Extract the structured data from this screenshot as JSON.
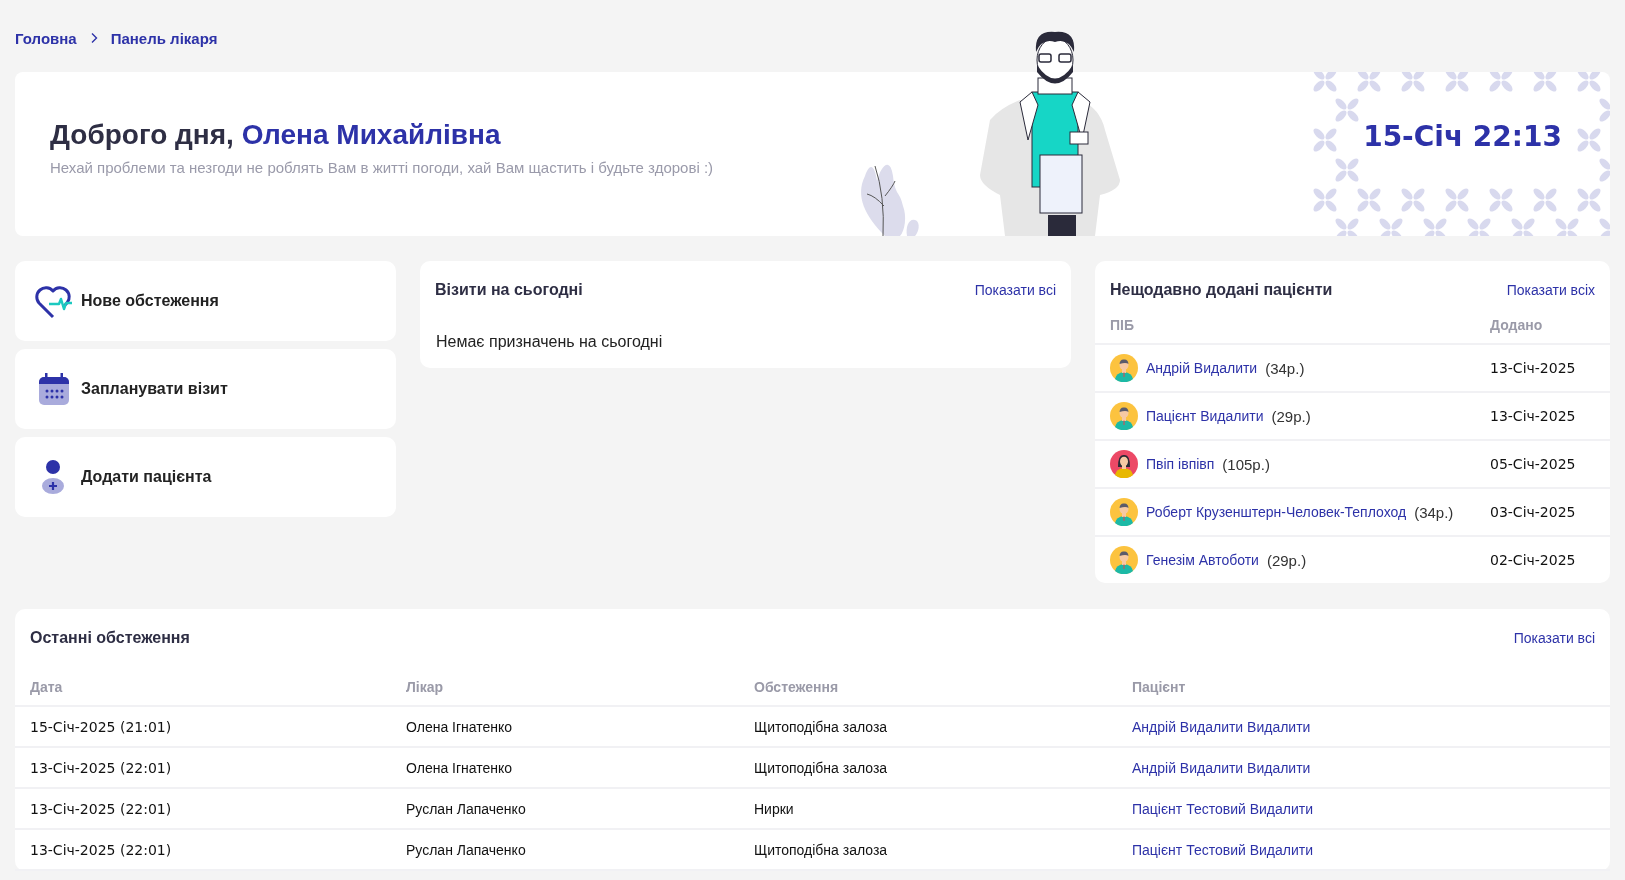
{
  "breadcrumb": [
    {
      "label": "Головна"
    },
    {
      "label": "Панель лікаря"
    }
  ],
  "banner": {
    "greeting": "Доброго дня,",
    "name": "Олена Михайлівна",
    "subtitle": "Нехай проблеми та незгоди не роблять Вам в житті погоди, хай Вам щастить і будьте здорові :)",
    "datetime": "15-Січ 22:13"
  },
  "actions": [
    {
      "label": "Нове обстеження",
      "kind": "heart"
    },
    {
      "label": "Запланувати візит",
      "kind": "calendar"
    },
    {
      "label": "Додати пацієнта",
      "kind": "person"
    }
  ],
  "visits": {
    "title": "Візити на сьогодні",
    "link": "Показати всі",
    "empty_text": "Немає призначень на сьогодні"
  },
  "recent_patients": {
    "title": "Нещодавно додані пацієнти",
    "link": "Показати всіх",
    "columns": [
      "ПІБ",
      "Додано"
    ],
    "rows": [
      {
        "name": "Андрій Видалити",
        "age": "(34р.)",
        "added": "13-Січ-2025",
        "kind": "male"
      },
      {
        "name": "Пацієнт Видалити",
        "age": "(29р.)",
        "added": "13-Січ-2025",
        "kind": "male"
      },
      {
        "name": "Пвіп івпівп",
        "age": "(105р.)",
        "added": "05-Січ-2025",
        "kind": "female"
      },
      {
        "name": "Роберт Крузенштерн-Человек-Теплоход",
        "age": "(34р.)",
        "added": "03-Січ-2025",
        "kind": "male"
      },
      {
        "name": "Генезім Автоботи",
        "age": "(29р.)",
        "added": "02-Січ-2025",
        "kind": "male"
      }
    ]
  },
  "exams": {
    "title": "Останні обстеження",
    "link": "Показати всі",
    "columns": [
      "Дата",
      "Лікар",
      "Обстеження",
      "Пацієнт"
    ],
    "rows": [
      {
        "date": "15-Січ-2025 (21:01)",
        "doctor": "Олена Ігнатенко",
        "exam": "Щитоподібна залоза",
        "patient": "Андрій Видалити Видалити"
      },
      {
        "date": "13-Січ-2025 (22:01)",
        "doctor": "Олена Ігнатенко",
        "exam": "Щитоподібна залоза",
        "patient": "Андрій Видалити Видалити"
      },
      {
        "date": "13-Січ-2025 (22:01)",
        "doctor": "Руслан Лапаченко",
        "exam": "Нирки",
        "patient": "Пацієнт Тестовий Видалити"
      },
      {
        "date": "13-Січ-2025 (22:01)",
        "doctor": "Руслан Лапаченко",
        "exam": "Щитоподібна залоза",
        "patient": "Пацієнт Тестовий Видалити"
      }
    ]
  }
}
